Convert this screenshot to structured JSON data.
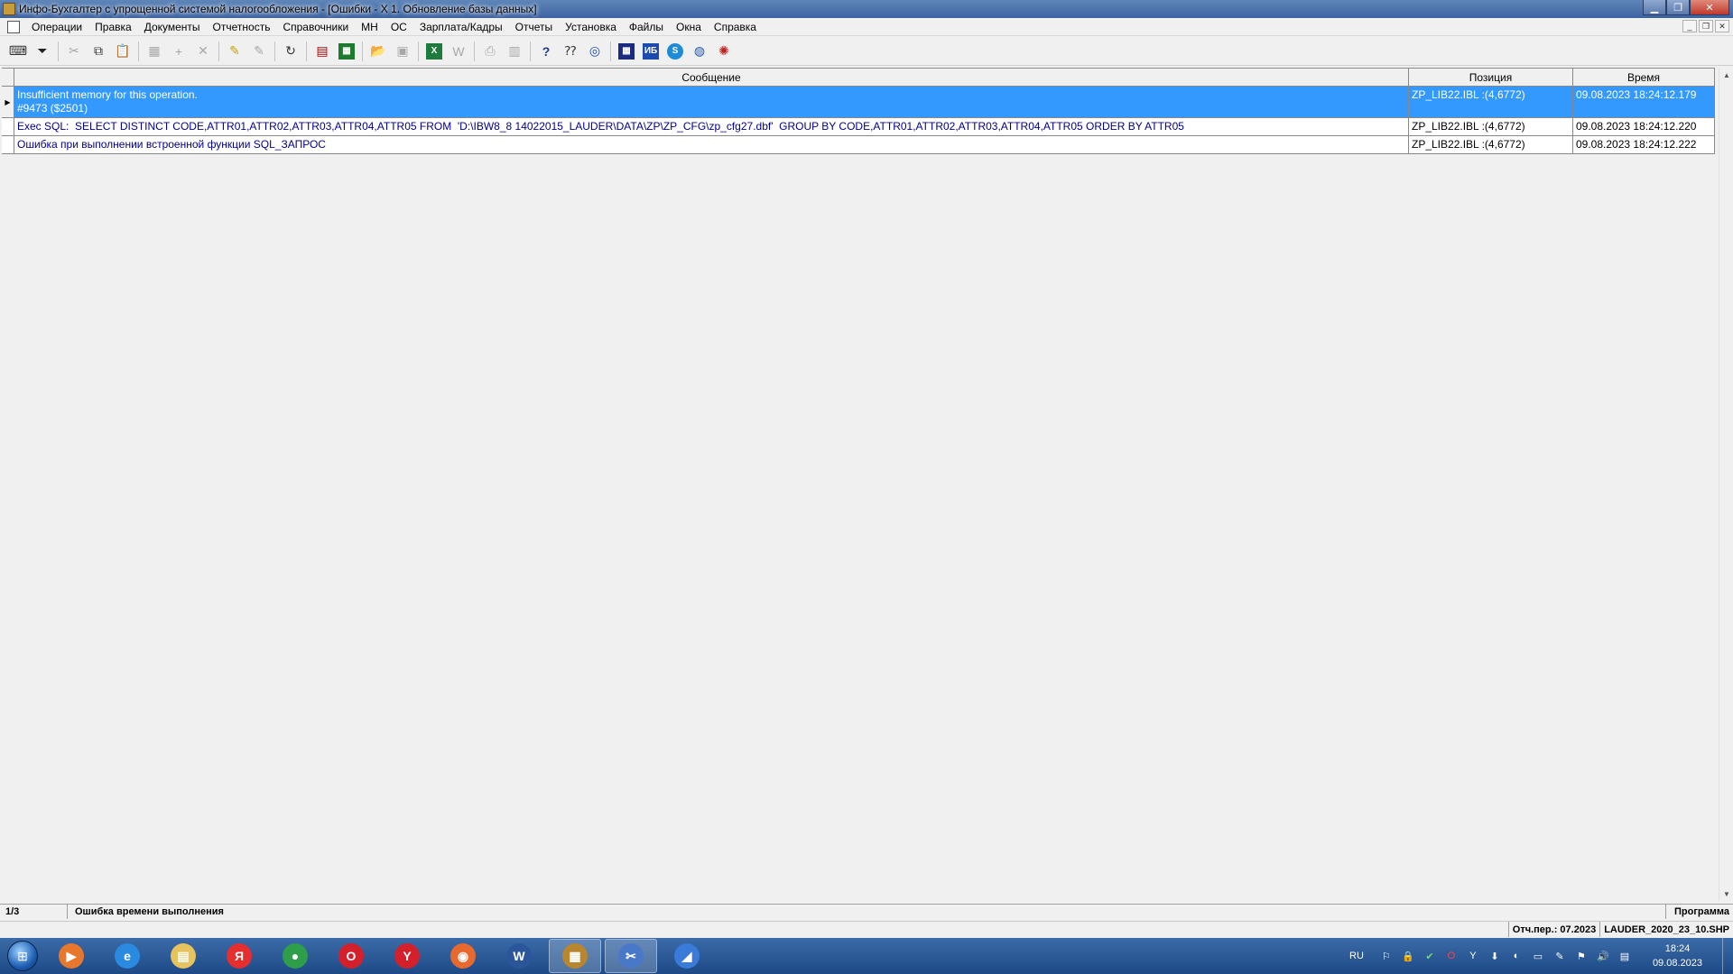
{
  "window": {
    "title": "Инфо-Бухгалтер с упрощенной системой налогообложения - [Ошибки - X 1. Обновление базы данных]"
  },
  "menu": [
    "Операции",
    "Правка",
    "Документы",
    "Отчетность",
    "Справочники",
    "МН",
    "ОС",
    "Зарплата/Кадры",
    "Отчеты",
    "Установка",
    "Файлы",
    "Окна",
    "Справка"
  ],
  "grid": {
    "columns": {
      "message": "Сообщение",
      "position": "Позиция",
      "time": "Время"
    },
    "rows": [
      {
        "message": "Insufficient memory for this operation.\n#9473 ($2501)",
        "position": "ZP_LIB22.IBL :(4,6772)",
        "time": "09.08.2023 18:24:12.179",
        "selected": true
      },
      {
        "message": "Exec SQL:  SELECT DISTINCT CODE,ATTR01,ATTR02,ATTR03,ATTR04,ATTR05 FROM  'D:\\IBW8_8 14022015_LAUDER\\DATA\\ZP\\ZP_CFG\\zp_cfg27.dbf'  GROUP BY CODE,ATTR01,ATTR02,ATTR03,ATTR04,ATTR05 ORDER BY ATTR05",
        "position": "ZP_LIB22.IBL :(4,6772)",
        "time": "09.08.2023 18:24:12.220",
        "selected": false
      },
      {
        "message": "Ошибка при выполнении встроенной функции SQL_ЗАПРОС",
        "position": "ZP_LIB22.IBL :(4,6772)",
        "time": "09.08.2023 18:24:12.222",
        "selected": false
      }
    ]
  },
  "status": {
    "count": "1/3",
    "type": "Ошибка времени выполнения",
    "source": "Программа",
    "period": "Отч.пер.: 07.2023",
    "file": "LAUDER_2020_23_10.SHP"
  },
  "taskbar": {
    "lang": "RU",
    "time": "18:24",
    "date": "09.08.2023",
    "apps": [
      {
        "name": "media-player",
        "color": "#e8772e",
        "glyph": "▶"
      },
      {
        "name": "internet-explorer",
        "color": "#2a8ae0",
        "glyph": "e"
      },
      {
        "name": "file-explorer",
        "color": "#e6c35c",
        "glyph": "▤"
      },
      {
        "name": "yandex",
        "color": "#e62e2e",
        "glyph": "Я"
      },
      {
        "name": "chrome",
        "color": "#2e9e4a",
        "glyph": "●"
      },
      {
        "name": "opera",
        "color": "#d4202a",
        "glyph": "O"
      },
      {
        "name": "yandex-browser",
        "color": "#d4202a",
        "glyph": "Y"
      },
      {
        "name": "firefox",
        "color": "#e8692e",
        "glyph": "◉"
      },
      {
        "name": "word",
        "color": "#2b579a",
        "glyph": "W"
      },
      {
        "name": "info-buhgalter",
        "color": "#b8862e",
        "glyph": "▦"
      },
      {
        "name": "network-tool",
        "color": "#4a78c8",
        "glyph": "✂"
      },
      {
        "name": "browser",
        "color": "#3a7ad8",
        "glyph": "◢"
      }
    ]
  },
  "colors": {
    "selection": "#3399ff",
    "text": "#00008b"
  }
}
